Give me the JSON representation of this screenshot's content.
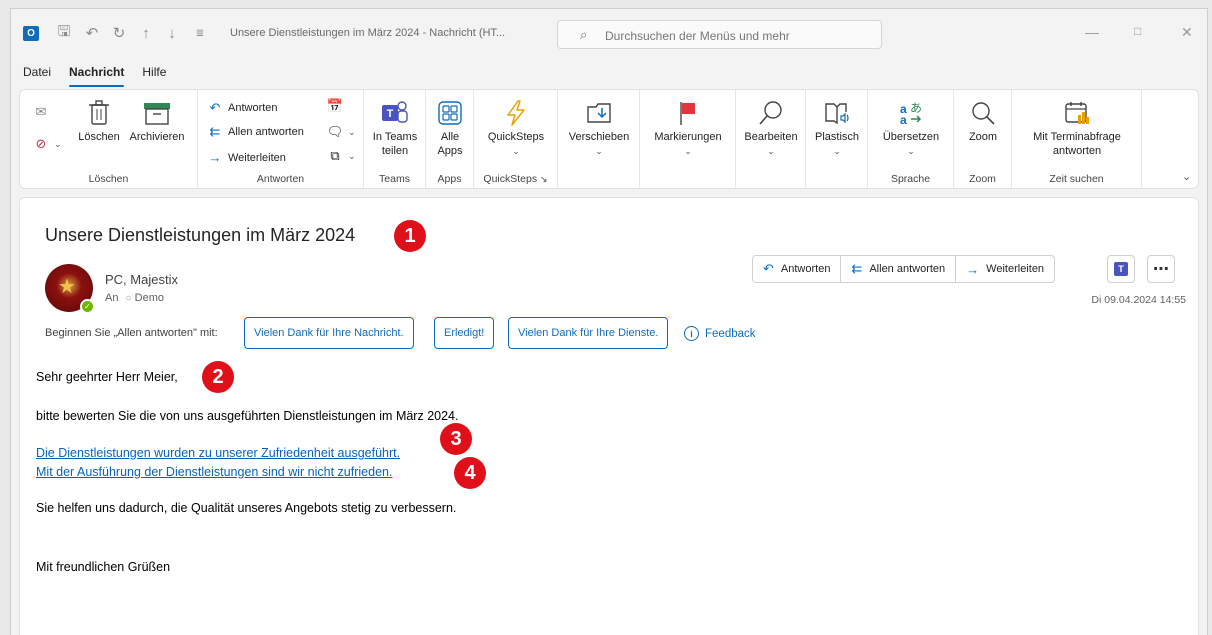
{
  "titlebar": {
    "logo": "O",
    "title": "Unsere Dienstleistungen im März 2024  -  Nachricht (HT...",
    "search_placeholder": "Durchsuchen der Menüs und mehr"
  },
  "menu_tabs": [
    "Datei",
    "Nachricht",
    "Hilfe"
  ],
  "ribbon": {
    "delete_group": {
      "delete": "Löschen",
      "archive": "Archivieren",
      "label": "Löschen"
    },
    "reply_group": {
      "reply": "Antworten",
      "reply_all": "Allen antworten",
      "forward": "Weiterleiten",
      "label": "Antworten"
    },
    "teams_group": {
      "share_line1": "In Teams",
      "share_line2": "teilen",
      "label": "Teams"
    },
    "apps_group": {
      "apps_line1": "Alle",
      "apps_line2": "Apps",
      "label": "Apps"
    },
    "quicksteps_group": {
      "quicksteps": "QuickSteps",
      "label": "QuickSteps"
    },
    "move": "Verschieben",
    "tags": "Markierungen",
    "edit": "Bearbeiten",
    "immersive": "Plastisch",
    "translate_group": {
      "translate": "Übersetzen",
      "label": "Sprache"
    },
    "zoom_group": {
      "zoom": "Zoom",
      "label": "Zoom"
    },
    "scheduling_group": {
      "line1": "Mit Terminabfrage",
      "line2": "antworten",
      "label": "Zeit suchen"
    }
  },
  "message": {
    "subject": "Unsere Dienstleistungen im März 2024",
    "sender": "PC, Majestix",
    "to_label": "An",
    "to_value": "Demo",
    "datetime": "Di 09.04.2024 14:55",
    "actions": {
      "reply": "Antworten",
      "reply_all": "Allen antworten",
      "forward": "Weiterleiten"
    },
    "suggest_label": "Beginnen Sie „Allen antworten\" mit:",
    "suggestions": [
      "Vielen Dank für Ihre Nachricht.",
      "Erledigt!",
      "Vielen Dank für Ihre Dienste."
    ],
    "feedback": "Feedback",
    "body": {
      "greeting": "Sehr geehrter Herr Meier,",
      "intro": "bitte bewerten Sie die von uns ausgeführten Dienstleistungen im März 2024.",
      "link_positive": "Die Dienstleistungen wurden zu unserer Zufriedenheit ausgeführt.",
      "link_negative": "Mit der Ausführung der Dienstleistungen sind wir nicht zufrieden.",
      "outro": "Sie helfen uns dadurch, die Qualität unseres Angebots stetig zu verbessern.",
      "closing": "Mit freundlichen Grüßen"
    }
  },
  "markers": [
    "1",
    "2",
    "3",
    "4"
  ]
}
